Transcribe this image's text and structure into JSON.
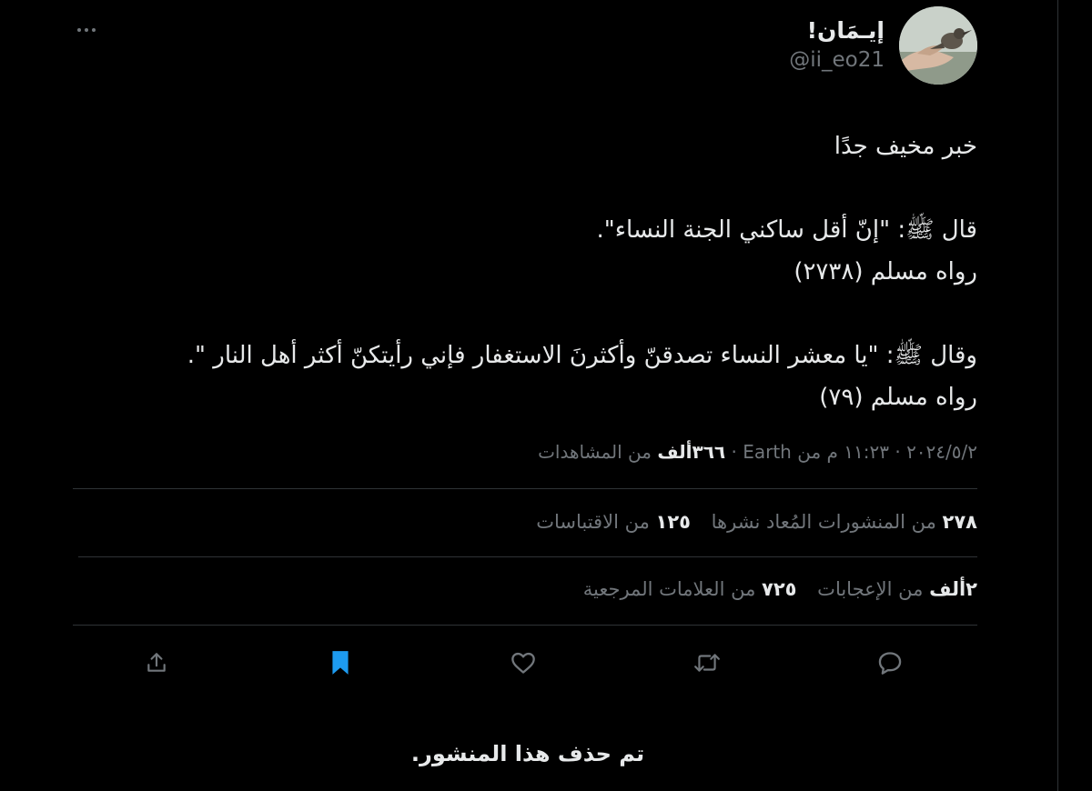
{
  "author": {
    "display_name": "إيـمَان!",
    "handle": "@ii_eo21",
    "avatar_icon": "bird-on-hand-avatar"
  },
  "tweet": {
    "lines": [
      "خبر مخيف جدًا",
      "",
      "قال ﷺ: \"إنّ أقل ساكني الجنة النساء\".",
      "رواه مسلم (٢٧٣٨)",
      "",
      "وقال ﷺ: \"يا معشر النساء تصدقنّ وأكثرنَ الاستغفار فإني رأيتكنّ أكثر أهل النار \".",
      "رواه مسلم (٧٩)"
    ]
  },
  "meta": {
    "date": "٢٠٢٤/٥/٢",
    "time": "١١:٢٣ م من",
    "source": "Earth",
    "views_count": "٣٦٦ألف",
    "views_label": "من المشاهدات",
    "separator": "·"
  },
  "stats": {
    "reposts_count": "٢٧٨",
    "reposts_label": "من المنشورات المُعاد نشرها",
    "quotes_count": "١٢٥",
    "quotes_label": "من الاقتباسات",
    "likes_count": "٢ألف",
    "likes_label": "من الإعجابات",
    "bookmarks_count": "٧٢٥",
    "bookmarks_label": "من العلامات المرجعية"
  },
  "actions": {
    "reply_icon": "reply-icon",
    "repost_icon": "repost-icon",
    "like_icon": "heart-icon",
    "bookmark_icon": "bookmark-icon",
    "share_icon": "share-icon"
  },
  "deleted_notice": "تم حذف هذا المنشور.",
  "colors": {
    "background": "#000000",
    "text_primary": "#e7e9ea",
    "text_secondary": "#71767b",
    "divider": "#2f3336",
    "accent_blue": "#1d9bf0"
  }
}
